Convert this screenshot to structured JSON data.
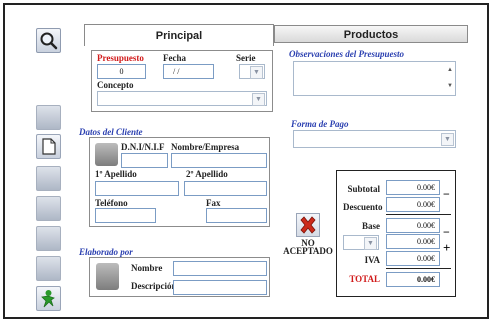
{
  "tabs": {
    "principal": "Principal",
    "productos": "Productos"
  },
  "presupuesto": {
    "presupuesto_label": "Presupuesto",
    "presupuesto_value": "0",
    "fecha_label": "Fecha",
    "fecha_value": "/ /",
    "serie_label": "Serie",
    "concepto_label": "Concepto"
  },
  "observaciones": {
    "title": "Observaciones del Presupuesto"
  },
  "cliente": {
    "title": "Datos del Cliente",
    "dni_label": "D.N.I/N.I.F",
    "nombre_empresa_label": "Nombre/Empresa",
    "apellido1_label": "1º Apellido",
    "apellido2_label": "2º Apellido",
    "telefono_label": "Teléfono",
    "fax_label": "Fax"
  },
  "forma_pago": {
    "title": "Forma de Pago"
  },
  "elaborado": {
    "title": "Elaborado por",
    "nombre_label": "Nombre",
    "descripcion_label": "Descripción"
  },
  "estado": {
    "line1": "NO",
    "line2": "ACEPTADO"
  },
  "totales": {
    "subtotal_label": "Subtotal",
    "subtotal_value": "0.00€",
    "descuento_label": "Descuento",
    "descuento_value": "0.00€",
    "base_label": "Base",
    "base_value": "0.00€",
    "extra_value": "0.00€",
    "iva_label": "IVA",
    "iva_value": "0.00€",
    "total_label": "TOTAL",
    "total_value": "0.00€",
    "minus_sign": "−",
    "plus_sign": "+"
  },
  "icons": {
    "search": "search-icon",
    "document": "document-icon",
    "accept": "accept-icon",
    "reject": "reject-icon"
  },
  "colors": {
    "accent_blue": "#2a3fb0",
    "label_red": "#d11b1b",
    "reject_red": "#cc2a1a",
    "accept_green": "#2a9a2a"
  }
}
